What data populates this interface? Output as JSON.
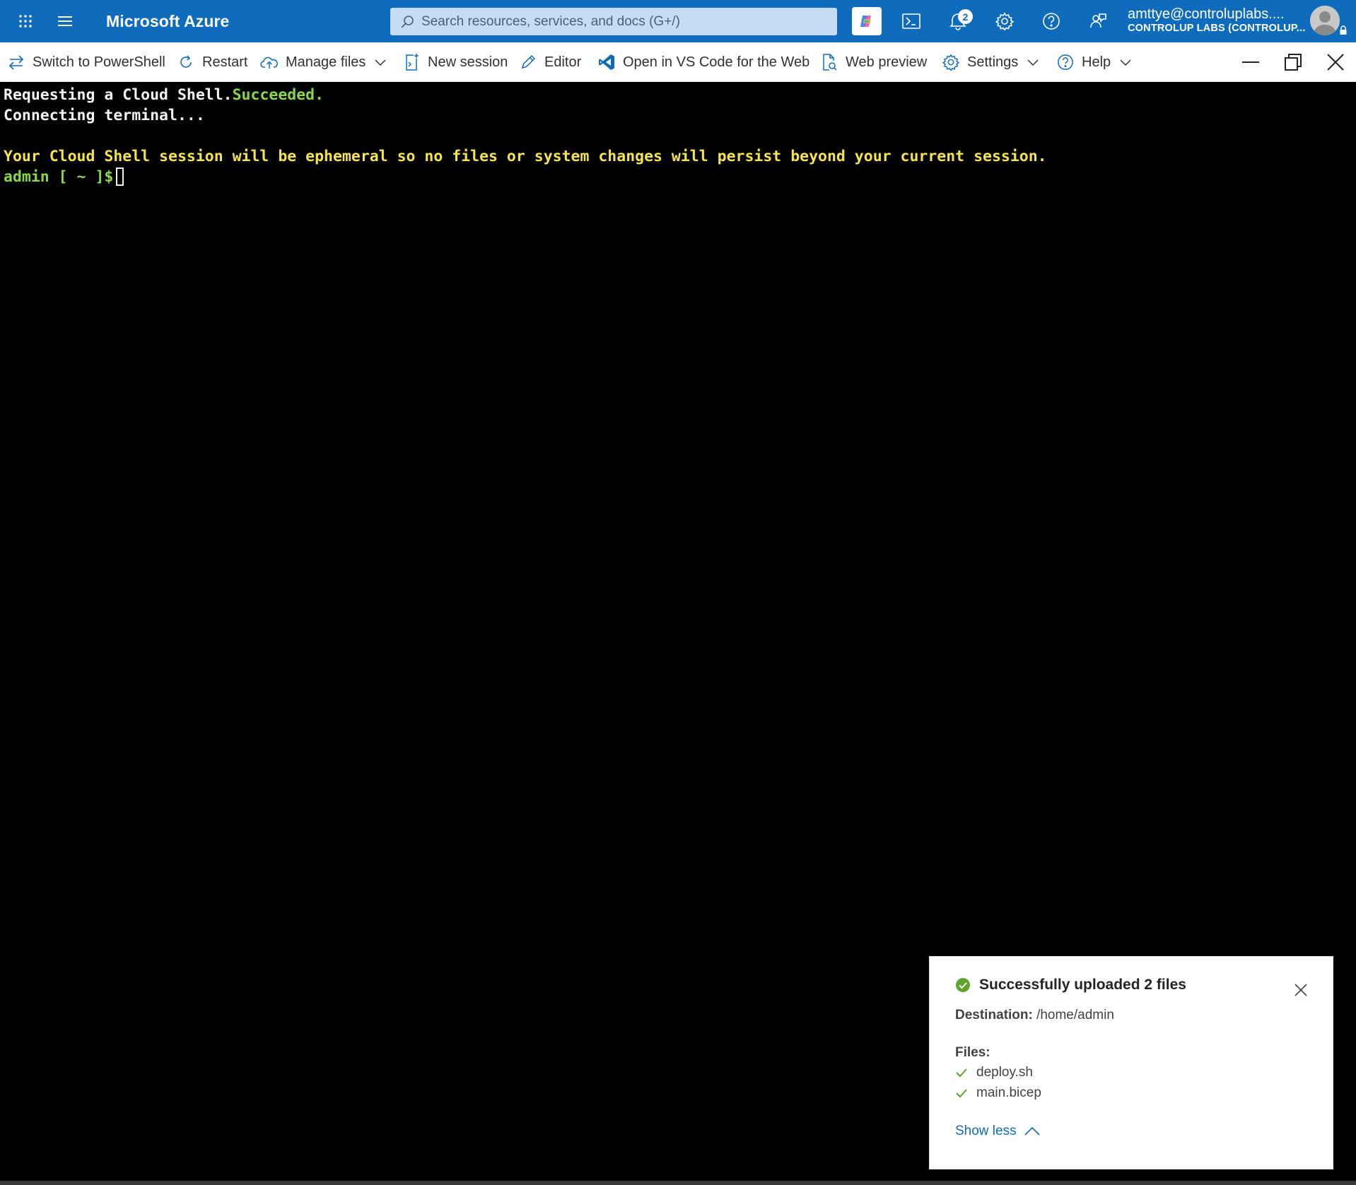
{
  "header": {
    "brand": "Microsoft Azure",
    "search_placeholder": "Search resources, services, and docs (G+/)",
    "notification_count": "2",
    "account_email": "amttye@controluplabs....",
    "account_tenant": "CONTROLUP LABS (CONTROLUP..."
  },
  "toolbar": {
    "switch": "Switch to PowerShell",
    "restart": "Restart",
    "manage_files": "Manage files",
    "new_session": "New session",
    "editor": "Editor",
    "vscode": "Open in VS Code for the Web",
    "web_preview": "Web preview",
    "settings": "Settings",
    "help": "Help"
  },
  "terminal": {
    "line1_text": "Requesting a Cloud Shell.",
    "line1_status": "Succeeded.",
    "line2": "Connecting terminal...",
    "warning": "Your Cloud Shell session will be ephemeral so no files or system changes will persist beyond your current session.",
    "prompt": "admin [ ~ ]$"
  },
  "toast": {
    "title": "Successfully uploaded 2 files",
    "destination_label": "Destination:",
    "destination_value": "/home/admin",
    "files_label": "Files:",
    "files": [
      "deploy.sh",
      "main.bicep"
    ],
    "toggle": "Show less"
  },
  "colors": {
    "azure_blue": "#0f6cbd",
    "success_green": "#8ad84a",
    "warning_yellow": "#f5e34a",
    "toast_check": "#5ea52b"
  },
  "icons": {
    "waffle": "app-launcher-icon",
    "menu": "hamburger-icon",
    "search": "search-icon",
    "copilot": "copilot-icon",
    "cloudshell": "cloud-shell-icon",
    "notifications": "bell-icon",
    "settings": "gear-icon",
    "help": "help-icon",
    "feedback": "feedback-icon"
  }
}
